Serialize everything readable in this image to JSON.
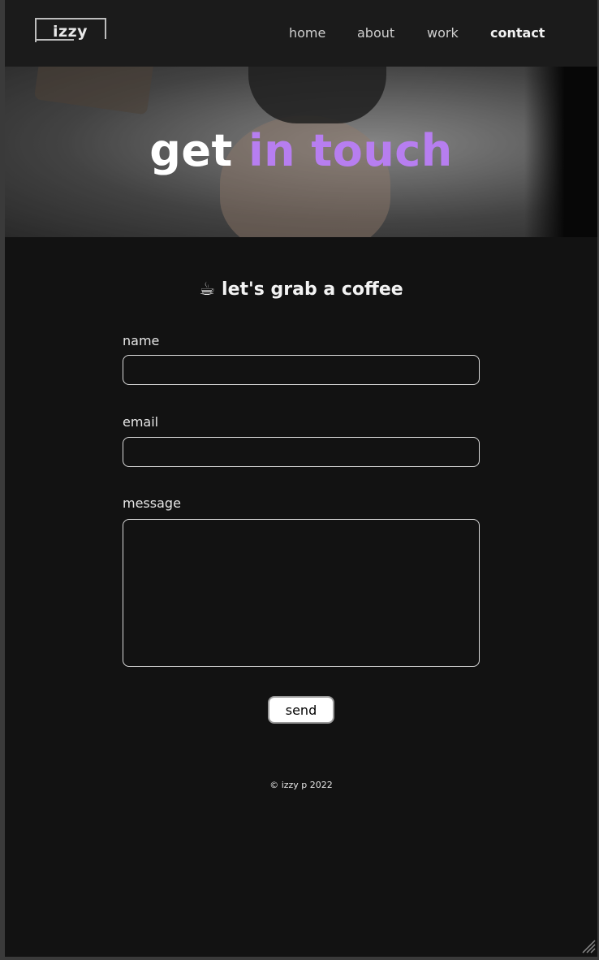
{
  "header": {
    "logo_text": "izzy",
    "nav": [
      {
        "label": "home",
        "active": false
      },
      {
        "label": "about",
        "active": false
      },
      {
        "label": "work",
        "active": false
      },
      {
        "label": "contact",
        "active": true
      }
    ]
  },
  "hero": {
    "title_prefix": "get",
    "title_accent": "in touch",
    "accent_color": "#b77ef0"
  },
  "form": {
    "title_emoji": "☕",
    "title": "let's grab a coffee",
    "name_label": "name",
    "name_value": "",
    "email_label": "email",
    "email_value": "",
    "message_label": "message",
    "message_value": "",
    "send_label": "send"
  },
  "footer": {
    "text": "© izzy p 2022"
  }
}
